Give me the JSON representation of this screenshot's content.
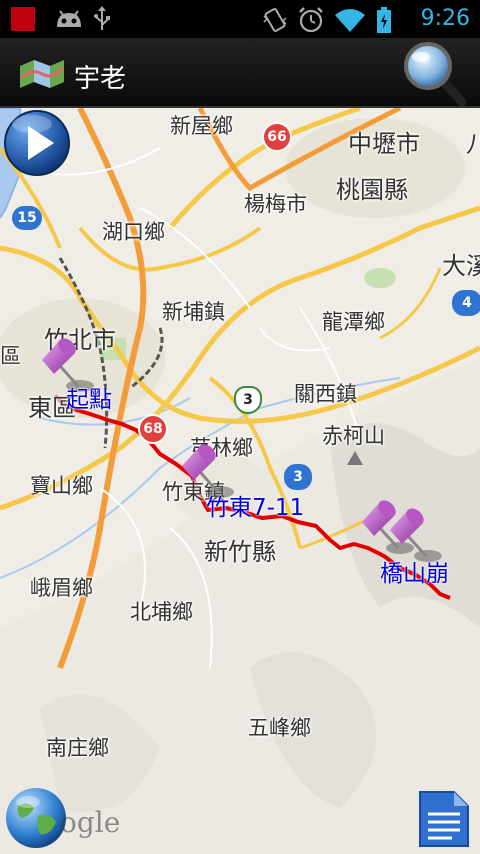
{
  "status_bar": {
    "time": "9:26",
    "icons": [
      "red-notification-icon",
      "android-debug-icon",
      "usb-icon",
      "vibrate-icon",
      "alarm-icon",
      "wifi-icon",
      "battery-icon"
    ]
  },
  "action_bar": {
    "title": "宇老",
    "app_icon": "map-icon",
    "search_icon": "magnifier-icon"
  },
  "map": {
    "places": [
      {
        "id": "xinwu",
        "text": "新屋鄉"
      },
      {
        "id": "zhongli",
        "text": "中壢市"
      },
      {
        "id": "ba",
        "text": "八"
      },
      {
        "id": "yangmei",
        "text": "楊梅市"
      },
      {
        "id": "taoyuan",
        "text": "桃園縣"
      },
      {
        "id": "hukou",
        "text": "湖口鄉"
      },
      {
        "id": "daxi",
        "text": "大溪"
      },
      {
        "id": "xinpu",
        "text": "新埔鎮"
      },
      {
        "id": "longtan",
        "text": "龍潭鄉"
      },
      {
        "id": "zhubei",
        "text": "竹北市"
      },
      {
        "id": "qu",
        "text": "區"
      },
      {
        "id": "dong",
        "text": "東區"
      },
      {
        "id": "guanxi",
        "text": "關西鎮"
      },
      {
        "id": "qionglin",
        "text": "芎林鄉"
      },
      {
        "id": "chikeshan",
        "text": "赤柯山"
      },
      {
        "id": "baoshan",
        "text": "寶山鄉"
      },
      {
        "id": "zhudong",
        "text": "竹東鎮"
      },
      {
        "id": "hsinchu",
        "text": "新竹縣"
      },
      {
        "id": "emei",
        "text": "峨眉鄉"
      },
      {
        "id": "beipu",
        "text": "北埔鄉"
      },
      {
        "id": "wufeng",
        "text": "五峰鄉"
      },
      {
        "id": "nanzhuang",
        "text": "南庄鄉"
      }
    ],
    "highway_shields": [
      "15",
      "66",
      "68",
      "3",
      "3",
      "4"
    ],
    "markers": [
      {
        "id": "start",
        "label": "起點"
      },
      {
        "id": "zhudong711",
        "label": "竹東7-11"
      },
      {
        "id": "qiaoshanbeng",
        "label": "橋山崩"
      }
    ],
    "colors": {
      "route": "#e00000",
      "marker_label": "#0000e0",
      "highway": "#f6c84a",
      "water": "#a9c9f0"
    }
  },
  "controls": {
    "play_icon": "play-icon",
    "globe_icon": "globe-icon",
    "google_logo_text": "ogle",
    "doc_icon": "document-icon"
  }
}
